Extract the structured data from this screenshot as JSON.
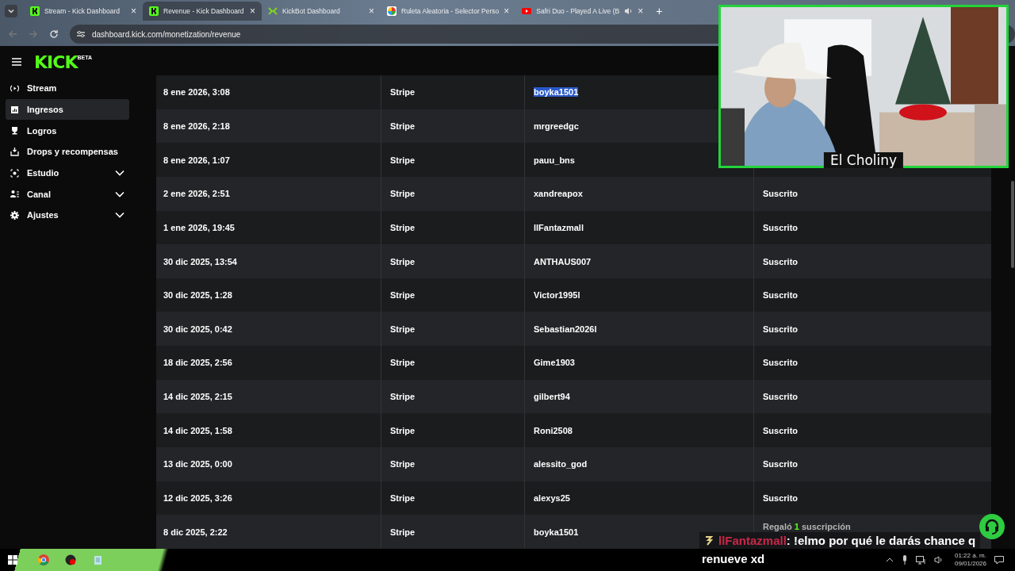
{
  "browser": {
    "tabs": [
      {
        "title": "Stream - Kick Dashboard",
        "selected": false,
        "audio": false
      },
      {
        "title": "Revenue - Kick Dashboard",
        "selected": true,
        "audio": false
      },
      {
        "title": "KickBot Dashboard",
        "selected": false,
        "audio": false
      },
      {
        "title": "Ruleta Aleatoria - Selector Perso",
        "selected": false,
        "audio": false
      },
      {
        "title": "Safri Duo - Played A Live (B",
        "selected": false,
        "audio": true
      }
    ],
    "close": "×",
    "new_tab": "+",
    "url": "dashboard.kick.com/monetization/revenue"
  },
  "logo": {
    "text": "KICK",
    "badge": "BETA"
  },
  "sidebar": {
    "items": [
      {
        "label": "Stream",
        "selected": false,
        "expandable": false
      },
      {
        "label": "Ingresos",
        "selected": true,
        "expandable": false
      },
      {
        "label": "Logros",
        "selected": false,
        "expandable": false
      },
      {
        "label": "Drops y recompensas",
        "selected": false,
        "expandable": false
      },
      {
        "label": "Estudio",
        "selected": false,
        "expandable": true
      },
      {
        "label": "Canal",
        "selected": false,
        "expandable": true
      },
      {
        "label": "Ajustes",
        "selected": false,
        "expandable": true
      }
    ]
  },
  "table": {
    "rows": [
      {
        "date": "8 ene 2026, 3:08",
        "method": "Stripe",
        "user": "boyka1501",
        "user_highlighted": true
      },
      {
        "date": "8 ene 2026, 2:18",
        "method": "Stripe",
        "user": "mrgreedgc",
        "user_highlighted": false
      },
      {
        "date": "8 ene 2026, 1:07",
        "method": "Stripe",
        "user": "pauu_bns",
        "user_highlighted": false
      },
      {
        "date": "2 ene 2026, 2:51",
        "method": "Stripe",
        "user": "xandreapox",
        "user_highlighted": false,
        "type": "Suscrito"
      },
      {
        "date": "1 ene 2026, 19:45",
        "method": "Stripe",
        "user": "llFantazmall",
        "user_highlighted": false,
        "type": "Suscrito"
      },
      {
        "date": "30 dic 2025, 13:54",
        "method": "Stripe",
        "user": "ANTHAUS007",
        "user_highlighted": false,
        "type": "Suscrito"
      },
      {
        "date": "30 dic 2025, 1:28",
        "method": "Stripe",
        "user": "Victor1995l",
        "user_highlighted": false,
        "type": "Suscrito"
      },
      {
        "date": "30 dic 2025, 0:42",
        "method": "Stripe",
        "user": "Sebastian2026l",
        "user_highlighted": false,
        "type": "Suscrito"
      },
      {
        "date": "18 dic 2025, 2:56",
        "method": "Stripe",
        "user": "Gime1903",
        "user_highlighted": false,
        "type": "Suscrito"
      },
      {
        "date": "14 dic 2025, 2:15",
        "method": "Stripe",
        "user": "gilbert94",
        "user_highlighted": false,
        "type": "Suscrito"
      },
      {
        "date": "14 dic 2025, 1:58",
        "method": "Stripe",
        "user": "Roni2508",
        "user_highlighted": false,
        "type": "Suscrito"
      },
      {
        "date": "13 dic 2025, 0:00",
        "method": "Stripe",
        "user": "alessito_god",
        "user_highlighted": false,
        "type": "Suscrito"
      },
      {
        "date": "12 dic 2025, 3:26",
        "method": "Stripe",
        "user": "alexys25",
        "user_highlighted": false,
        "type": "Suscrito"
      },
      {
        "date": "8 dic 2025, 2:22",
        "method": "Stripe",
        "user": "boyka1501",
        "user_highlighted": false,
        "type_parts": {
          "before": "Regaló",
          "count": "1",
          "after": "suscripción"
        }
      }
    ]
  },
  "webcam": {
    "name": "El Choliny"
  },
  "chat": {
    "user": "llFantazmall",
    "message": ": !elmo por qué le darás chance q",
    "message_continued": "renueve xd"
  },
  "taskbar": {
    "time": "01:22 a. m.",
    "date": "09/01/2026"
  }
}
